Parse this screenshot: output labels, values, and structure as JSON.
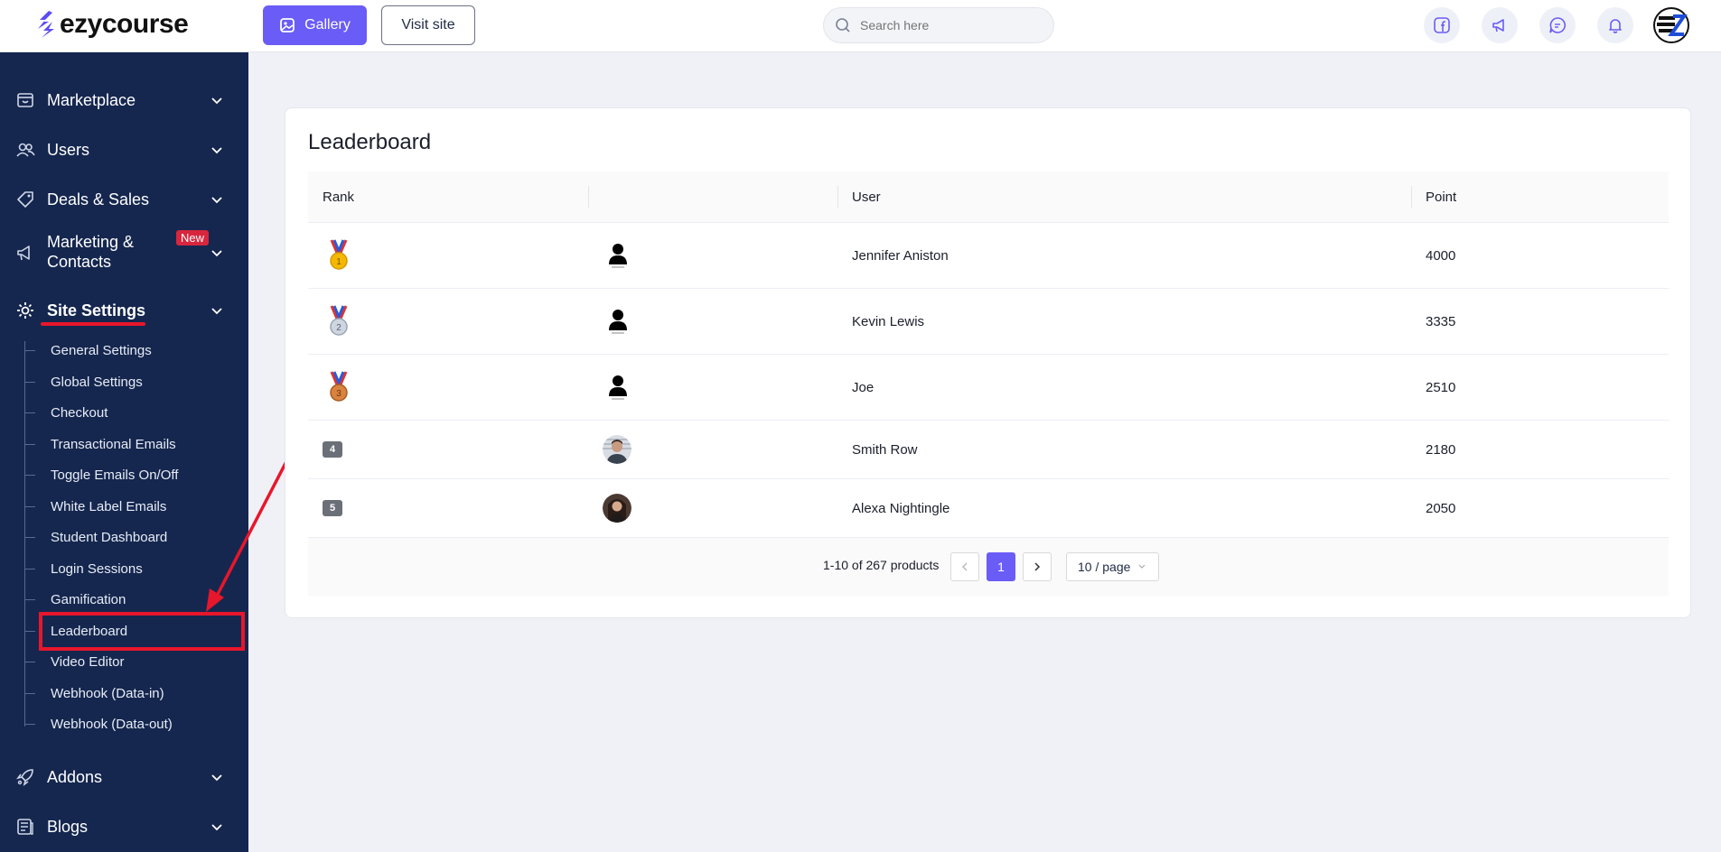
{
  "brand": {
    "name": "ezycourse"
  },
  "topbar": {
    "gallery_label": "Gallery",
    "visit_label": "Visit site",
    "search_placeholder": "Search here"
  },
  "sidebar": {
    "items": [
      {
        "label": "Marketplace"
      },
      {
        "label": "Users"
      },
      {
        "label": "Deals & Sales"
      },
      {
        "label": "Marketing &",
        "label2": "Contacts",
        "badge": "New"
      },
      {
        "label": "Site Settings"
      },
      {
        "label": "Addons"
      },
      {
        "label": "Blogs"
      }
    ],
    "sub_items": [
      "General Settings",
      "Global Settings",
      "Checkout",
      "Transactional Emails",
      "Toggle Emails On/Off",
      "White Label Emails",
      "Student Dashboard",
      "Login Sessions",
      "Gamification",
      "Leaderboard",
      "Video Editor",
      "Webhook (Data-in)",
      "Webhook (Data-out)"
    ]
  },
  "leaderboard": {
    "title": "Leaderboard",
    "columns": [
      "Rank",
      "",
      "User",
      "Point"
    ],
    "rows": [
      {
        "rank": "1",
        "user": "Jennifer Aniston",
        "point": "4000",
        "medal": "gold",
        "avatar": "placeholder"
      },
      {
        "rank": "2",
        "user": "Kevin Lewis",
        "point": "3335",
        "medal": "silver",
        "avatar": "placeholder"
      },
      {
        "rank": "3",
        "user": "Joe",
        "point": "2510",
        "medal": "bronze",
        "avatar": "placeholder"
      },
      {
        "rank": "4",
        "user": "Smith Row",
        "point": "2180",
        "medal": "",
        "avatar": "photo"
      },
      {
        "rank": "5",
        "user": "Alexa Nightingle",
        "point": "2050",
        "medal": "",
        "avatar": "photo"
      }
    ],
    "pagination": {
      "info": "1-10 of 267 products",
      "current_page": "1",
      "page_size": "10 / page"
    }
  },
  "colors": {
    "accent": "#6a5cf6",
    "sidebar_bg": "#15274f",
    "highlight_red": "#e8162b"
  }
}
